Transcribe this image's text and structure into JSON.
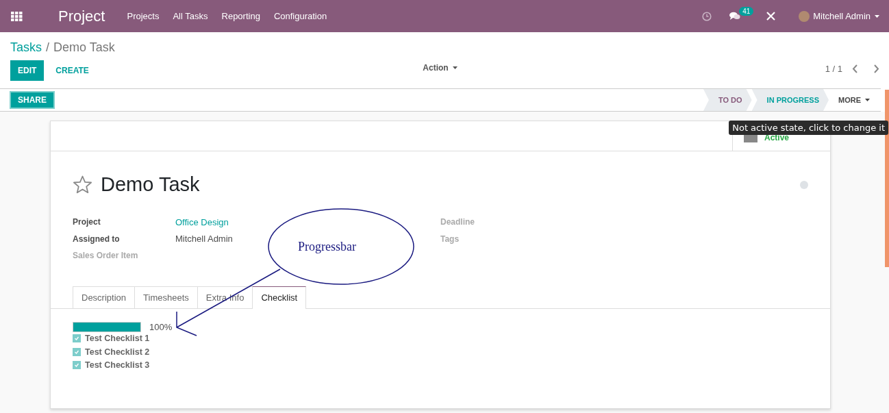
{
  "navbar": {
    "app_name": "Project",
    "menu": [
      "Projects",
      "All Tasks",
      "Reporting",
      "Configuration"
    ],
    "message_count": "41",
    "user": "Mitchell Admin"
  },
  "breadcrumb": {
    "parent": "Tasks",
    "separator": "/",
    "current": "Demo Task"
  },
  "buttons": [
    {
      "label": "EDIT",
      "kind": "primary"
    },
    {
      "label": "CREATE",
      "kind": "link"
    }
  ],
  "action_menu": "Action",
  "pager": "1 / 1",
  "status_bar": {
    "buttons": [
      "SHARE"
    ],
    "stages": [
      {
        "label": "TO DO",
        "selected": false
      },
      {
        "label": "IN PROGRESS",
        "selected": true
      }
    ],
    "more": "MORE"
  },
  "tooltip": "Not active state, click to change it",
  "sheet": {
    "smart_button": "Active",
    "title": "Demo Task",
    "starred": false,
    "fields_left": [
      {
        "label": "Project",
        "value": "Office Design",
        "kind": "link",
        "muted": false
      },
      {
        "label": "Assigned to",
        "value": "Mitchell Admin",
        "kind": "text",
        "muted": false
      },
      {
        "label": "Sales Order Item",
        "muted": true
      }
    ],
    "fields_right": [
      {
        "label": "Deadline",
        "muted": true
      },
      {
        "label": "Tags",
        "muted": true
      }
    ],
    "tabs": [
      {
        "label": "Description",
        "selected": false
      },
      {
        "label": "Timesheets",
        "selected": false
      },
      {
        "label": "Extra Info",
        "selected": false
      },
      {
        "label": "Checklist",
        "selected": true
      }
    ],
    "checklist": {
      "level": 1,
      "reading": "100%",
      "items": [
        {
          "label": "Test Checklist 1",
          "checked": true
        },
        {
          "label": "Test Checklist 2",
          "checked": true
        },
        {
          "label": "Test Checklist 3",
          "checked": true
        }
      ]
    }
  },
  "annotation": {
    "text": "Progressbar"
  }
}
